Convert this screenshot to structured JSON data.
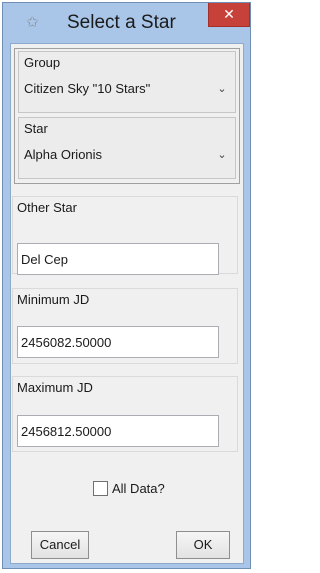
{
  "window": {
    "title": "Select a Star",
    "close_label": "✕",
    "app_icon": "star-icon"
  },
  "group_combo": {
    "label": "Group",
    "value": "Citizen Sky \"10 Stars\"",
    "chevron": "⌄"
  },
  "star_combo": {
    "label": "Star",
    "value": "Alpha Orionis",
    "chevron": "⌄"
  },
  "other_star": {
    "label": "Other Star",
    "value": "Del Cep"
  },
  "minimum_jd": {
    "label": "Minimum JD",
    "value": "2456082.50000"
  },
  "maximum_jd": {
    "label": "Maximum JD",
    "value": "2456812.50000"
  },
  "all_data": {
    "label": "All Data?",
    "checked": false
  },
  "buttons": {
    "cancel": "Cancel",
    "ok": "OK"
  },
  "colors": {
    "titlebar": "#a9c6e8",
    "close": "#c7413b",
    "panel": "#f0f0f0"
  }
}
